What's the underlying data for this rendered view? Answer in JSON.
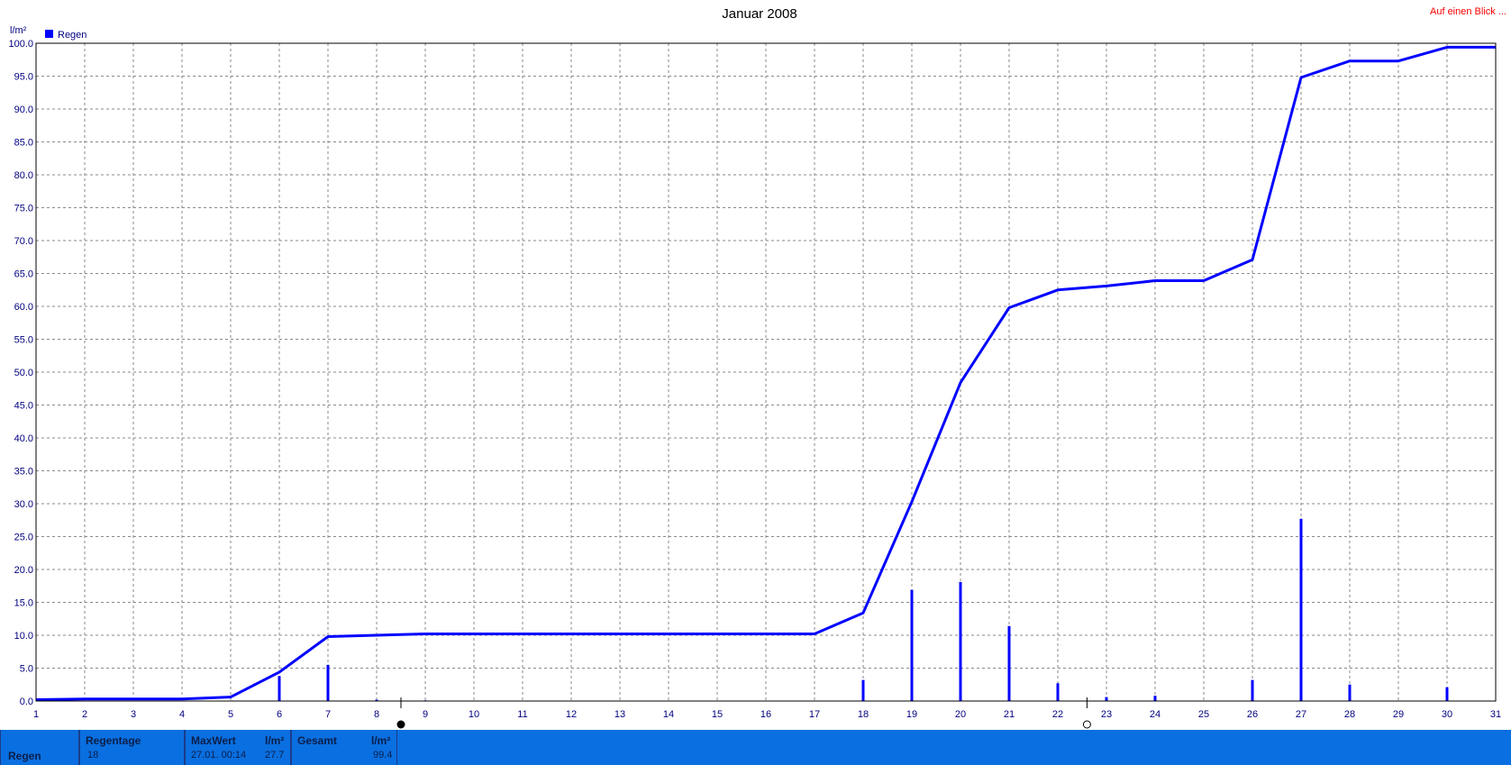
{
  "chart_data": {
    "type": "line",
    "title": "Januar 2008",
    "corner_link": "Auf einen Blick ...",
    "ylabel": "l/m²",
    "legend": {
      "label": "Regen",
      "color": "#0000ff",
      "placement": "top-left"
    },
    "ylim": [
      0,
      100
    ],
    "yticks": [
      "0.0",
      "5.0",
      "10.0",
      "15.0",
      "20.0",
      "25.0",
      "30.0",
      "35.0",
      "40.0",
      "45.0",
      "50.0",
      "55.0",
      "60.0",
      "65.0",
      "70.0",
      "75.0",
      "80.0",
      "85.0",
      "90.0",
      "95.0",
      "100.0"
    ],
    "xlim": [
      1,
      31
    ],
    "xticks": [
      "1",
      "2",
      "3",
      "4",
      "5",
      "6",
      "7",
      "8",
      "9",
      "10",
      "11",
      "12",
      "13",
      "14",
      "15",
      "16",
      "17",
      "18",
      "19",
      "20",
      "21",
      "22",
      "23",
      "24",
      "25",
      "26",
      "27",
      "28",
      "29",
      "30",
      "31"
    ],
    "grid": true,
    "series": [
      {
        "name": "Regen",
        "kind": "cumulative-line",
        "color": "#0000ff",
        "points": [
          [
            1,
            0.2
          ],
          [
            2,
            0.3
          ],
          [
            3,
            0.3
          ],
          [
            4,
            0.3
          ],
          [
            5,
            0.6
          ],
          [
            6,
            4.4
          ],
          [
            7,
            9.8
          ],
          [
            8,
            10.0
          ],
          [
            9,
            10.2
          ],
          [
            17,
            10.2
          ],
          [
            18,
            13.4
          ],
          [
            19,
            30.3
          ],
          [
            20,
            48.4
          ],
          [
            21,
            59.8
          ],
          [
            22,
            62.5
          ],
          [
            23,
            63.1
          ],
          [
            24,
            63.9
          ],
          [
            25,
            63.9
          ],
          [
            26,
            67.1
          ],
          [
            27,
            94.8
          ],
          [
            28,
            97.3
          ],
          [
            29,
            97.3
          ],
          [
            30,
            99.4
          ],
          [
            31,
            99.4
          ]
        ]
      },
      {
        "name": "Regen",
        "kind": "daily-bars",
        "color": "#0000ff",
        "points": [
          [
            6,
            3.8
          ],
          [
            7,
            5.5
          ],
          [
            8,
            0.2
          ],
          [
            9,
            0.1
          ],
          [
            18,
            3.2
          ],
          [
            19,
            16.9
          ],
          [
            20,
            18.1
          ],
          [
            21,
            11.4
          ],
          [
            22,
            2.7
          ],
          [
            23,
            0.6
          ],
          [
            24,
            0.8
          ],
          [
            26,
            3.2
          ],
          [
            27,
            27.7
          ],
          [
            28,
            2.5
          ],
          [
            30,
            2.1
          ]
        ]
      }
    ],
    "markers": [
      {
        "x": 8.5,
        "shape": "filled-circle"
      },
      {
        "x": 22.6,
        "shape": "open-circle"
      }
    ]
  },
  "summary": {
    "row_label": "Regen",
    "rain_days_label": "Regentage",
    "rain_days_value": "18",
    "max_label": "MaxWert",
    "max_unit": "l/m²",
    "max_datetime": "27.01.  00:14",
    "max_value": "27.7",
    "total_label": "Gesamt",
    "total_unit": "l/m²",
    "total_value": "99.4"
  }
}
